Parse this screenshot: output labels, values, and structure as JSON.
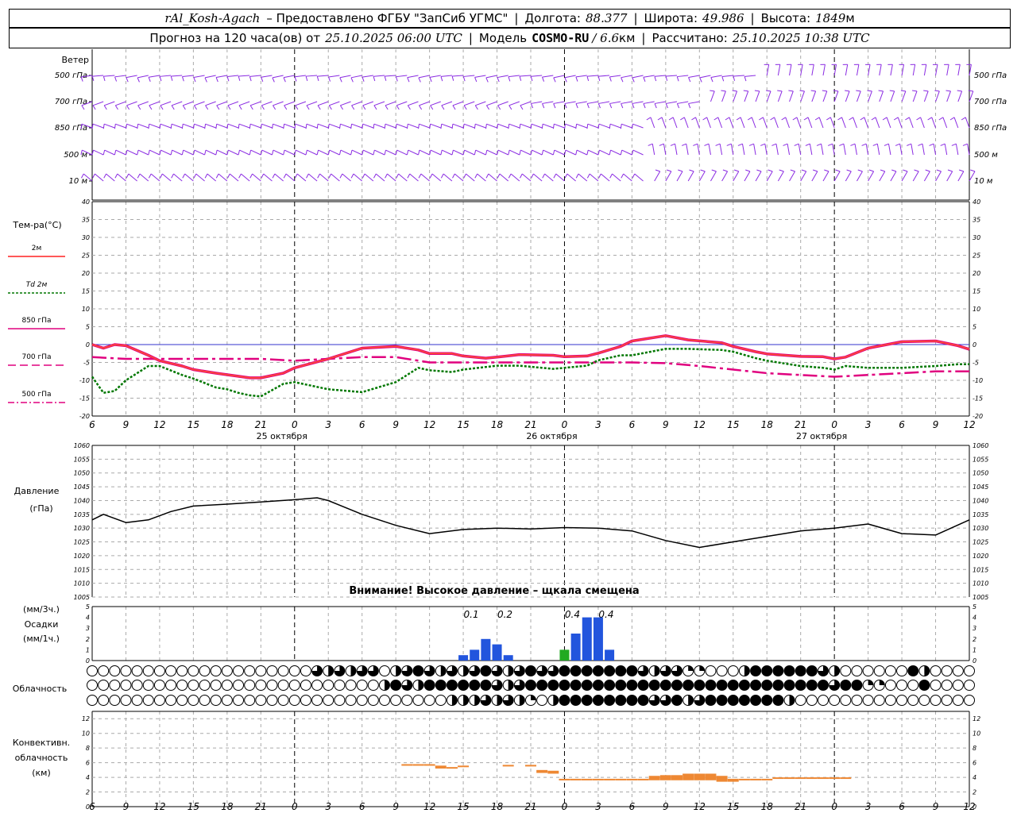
{
  "header": {
    "station": "rAl_Kosh-Agach",
    "provided_by": "– Предоставлено ФГБУ \"ЗапСиб УГМС\"",
    "lon_label": "Долгота:",
    "lon_value": "88.377",
    "lat_label": "Широта:",
    "lat_value": "49.986",
    "alt_label": "Высота:",
    "alt_value": "1849",
    "alt_unit": "м",
    "forecast_prefix": "Прогноз на 120 часа(ов) от",
    "forecast_start": "25.10.2025 06:00 UTC",
    "model_label": "Модель",
    "model_name": "COSMO-RU",
    "model_res": "/ 6.6",
    "model_res_unit": "км",
    "calc_label": "Рассчитано:",
    "calc_time": "25.10.2025 10:38 UTC"
  },
  "wind_panel": {
    "title": "Ветер",
    "levels": [
      "500 гПа",
      "700 гПа",
      "850 гПа",
      "500 м",
      "10 м"
    ],
    "color": "#8a2be2"
  },
  "x_axis": {
    "hour_labels": [
      "6",
      "9",
      "12",
      "15",
      "18",
      "21",
      "0",
      "3",
      "6",
      "9",
      "12",
      "15",
      "18",
      "21",
      "0",
      "3",
      "6",
      "9",
      "12",
      "15",
      "18",
      "21",
      "0",
      "3",
      "6",
      "9",
      "12"
    ],
    "date_labels": [
      "25 октября",
      "26 октября",
      "27 октября"
    ]
  },
  "temp_panel": {
    "title": "Тем-ра(°C)",
    "legend": [
      {
        "label": "2м",
        "color": "#ff2020",
        "style": "solid"
      },
      {
        "label": "Td 2м",
        "color": "#007700",
        "style": "dotted"
      },
      {
        "label": "850 гПа",
        "color": "#e0007f",
        "style": "solid"
      },
      {
        "label": "700 гПа",
        "color": "#e0007f",
        "style": "dashed"
      },
      {
        "label": "500 гПа",
        "color": "#e0007f",
        "style": "dashdot"
      }
    ],
    "y_ticks": [
      "40",
      "35",
      "30",
      "25",
      "20",
      "15",
      "10",
      "5",
      "0",
      "-5",
      "-10",
      "-15",
      "-20"
    ]
  },
  "pressure_panel": {
    "title": "Давление",
    "unit": "(гПа)",
    "y_ticks": [
      "1060",
      "1055",
      "1050",
      "1045",
      "1040",
      "1035",
      "1030",
      "1025",
      "1020",
      "1015",
      "1010",
      "1005"
    ],
    "warning": "Внимание! Высокое давление – щкала смещена"
  },
  "precip_panel": {
    "unit_3h": "(мм/3ч.)",
    "title": "Осадки",
    "unit_1h": "(мм/1ч.)",
    "y_ticks": [
      "5",
      "4",
      "3",
      "2",
      "1",
      "0"
    ],
    "labels": [
      {
        "hour": 33,
        "text": "0.1"
      },
      {
        "hour": 36,
        "text": "0.2"
      },
      {
        "hour": 42,
        "text": "0.4"
      },
      {
        "hour": 45,
        "text": "0.4"
      }
    ]
  },
  "cloud_panel": {
    "title": "Облачность"
  },
  "conv_panel": {
    "title1": "Конвективн.",
    "title2": "облачность",
    "unit": "(км)",
    "y_ticks": [
      "12",
      "10",
      "8",
      "6",
      "4",
      "2",
      "0"
    ],
    "color": "#ee8833"
  },
  "chart_data": [
    {
      "type": "line",
      "title": "Тем-ра(°C)",
      "x_unit": "hours from 25.10.2025 06:00 UTC",
      "ylim": [
        -20,
        40
      ],
      "series": [
        {
          "name": "2м",
          "x": [
            0,
            1,
            2,
            3,
            5,
            6,
            8,
            9,
            11,
            14,
            15,
            17,
            18,
            21,
            24,
            27,
            29,
            30,
            32,
            33,
            35,
            36,
            38,
            41,
            42,
            44,
            45,
            47,
            48,
            51,
            53,
            56,
            57,
            59,
            60,
            63,
            65,
            66,
            67,
            69,
            72,
            75,
            77,
            78
          ],
          "y": [
            0,
            -1,
            0,
            -0.3,
            -3,
            -4.5,
            -6,
            -7,
            -8,
            -9.3,
            -9.3,
            -8,
            -6.5,
            -4,
            -1,
            -0.5,
            -1.5,
            -2.5,
            -2.5,
            -3.2,
            -3.8,
            -3.5,
            -2.8,
            -3,
            -3.4,
            -3.2,
            -2.4,
            -0.5,
            1,
            2.5,
            1.3,
            0.5,
            -0.5,
            -2,
            -2.6,
            -3.3,
            -3.4,
            -4,
            -3.5,
            -1,
            0.8,
            1,
            -0.3,
            -1.3
          ]
        },
        {
          "name": "Td 2м",
          "x": [
            0,
            1,
            2,
            3,
            5,
            6,
            8,
            9,
            11,
            12,
            13,
            14,
            15,
            17,
            18,
            21,
            24,
            27,
            29,
            30,
            32,
            33,
            36,
            38,
            41,
            42,
            44,
            45,
            47,
            48,
            51,
            53,
            56,
            57,
            59,
            60,
            63,
            65,
            66,
            67,
            69,
            72,
            75,
            77,
            78
          ],
          "y": [
            -9,
            -13.5,
            -13,
            -10,
            -6,
            -6,
            -8.5,
            -9.5,
            -12,
            -12.5,
            -13.5,
            -14.2,
            -14.5,
            -11,
            -10.5,
            -12.5,
            -13.3,
            -10.5,
            -6.5,
            -7.2,
            -7.7,
            -7,
            -5.9,
            -5.9,
            -6.8,
            -6.5,
            -5.9,
            -4.4,
            -3,
            -3,
            -1.2,
            -1.2,
            -1.5,
            -2,
            -3.8,
            -4.5,
            -6,
            -6.5,
            -7,
            -6,
            -6.5,
            -6.5,
            -6,
            -5.5,
            -5.5
          ]
        },
        {
          "name": "850 гПа",
          "x": [
            0,
            1,
            2,
            3,
            5,
            6,
            8,
            9,
            11,
            14,
            15,
            17,
            18,
            21,
            24,
            27,
            29,
            30,
            32,
            33,
            35,
            36,
            38,
            41,
            42,
            44,
            45,
            47,
            48,
            51,
            53,
            56,
            57,
            59,
            60,
            63,
            65,
            66,
            67,
            69,
            72,
            75,
            77,
            78
          ],
          "y": [
            0,
            -1,
            0,
            -0.3,
            -3,
            -4.5,
            -6,
            -7,
            -8,
            -9.3,
            -9.3,
            -8,
            -6.5,
            -4,
            -1,
            -0.5,
            -1.5,
            -2.5,
            -2.5,
            -3.2,
            -3.8,
            -3.5,
            -2.8,
            -3,
            -3.4,
            -3.2,
            -2.4,
            -0.5,
            1,
            2.5,
            1.3,
            0.5,
            -0.5,
            -2,
            -2.6,
            -3.3,
            -3.4,
            -4,
            -3.5,
            -1,
            0.8,
            1,
            -0.3,
            -1.3
          ]
        },
        {
          "name": "700 гПа",
          "x": [
            0,
            3,
            6,
            9,
            12,
            15,
            18,
            21,
            24,
            27,
            30,
            33,
            36,
            39,
            42,
            45,
            48,
            51,
            54,
            57,
            60,
            63,
            66,
            69,
            72,
            75,
            78
          ],
          "y": [
            -3.5,
            -4,
            -4,
            -4,
            -4,
            -4,
            -4.5,
            -4,
            -3.5,
            -3.5,
            -5,
            -5,
            -5,
            -5,
            -5,
            -5,
            -5,
            -5.2,
            -6,
            -7,
            -8,
            -8.5,
            -9,
            -8.5,
            -8,
            -7.5,
            -7.5
          ]
        }
      ]
    },
    {
      "type": "line",
      "title": "Давление",
      "x_unit": "hours from 25.10.2025 06:00 UTC",
      "ylim": [
        1005,
        1060
      ],
      "series": [
        {
          "name": "Давление",
          "x": [
            0,
            1,
            3,
            5,
            7,
            9,
            12,
            15,
            18,
            20,
            21,
            24,
            27,
            30,
            33,
            36,
            39,
            42,
            45,
            48,
            51,
            54,
            57,
            60,
            63,
            66,
            69,
            72,
            75,
            78
          ],
          "y": [
            1033,
            1035,
            1032,
            1033,
            1036,
            1038,
            1038.7,
            1039.5,
            1040.3,
            1041,
            1040,
            1035,
            1031,
            1028,
            1029.5,
            1030,
            1029.7,
            1030.2,
            1030,
            1029,
            1025.5,
            1023,
            1025,
            1027,
            1029,
            1030,
            1031.5,
            1028,
            1027.5,
            1033
          ]
        }
      ]
    },
    {
      "type": "bar",
      "title": "Осадки",
      "x_unit": "hours from 25.10.2025 06:00 UTC",
      "ylim": [
        0,
        5
      ],
      "series": [
        {
          "name": "мм/1ч.",
          "x": [
            33,
            34,
            35,
            36,
            37,
            42,
            43,
            44,
            45,
            46
          ],
          "y": [
            0.05,
            0.1,
            0.2,
            0.15,
            0.05,
            0.1,
            0.25,
            0.4,
            0.4,
            0.1
          ]
        }
      ]
    },
    {
      "type": "bar",
      "title": "Конвективн. облачность (км)",
      "x_unit": "hours from 25.10.2025 06:00 UTC",
      "ylim": [
        0,
        13
      ],
      "series": [
        {
          "name": "top_km",
          "x": [
            28,
            29,
            30,
            31,
            32,
            33,
            37,
            39,
            40,
            41,
            42,
            43,
            44,
            45,
            46,
            47,
            48,
            49,
            50,
            51,
            52,
            53,
            54,
            55,
            56,
            57,
            58,
            59,
            60,
            61,
            62,
            63,
            64,
            65,
            66,
            67
          ],
          "y": [
            5.8,
            5.8,
            5.8,
            5.6,
            5.4,
            5.6,
            5.7,
            5.7,
            5,
            4.9,
            3.8,
            3.8,
            3.8,
            3.8,
            3.8,
            3.8,
            3.8,
            3.8,
            4.2,
            4.3,
            4.3,
            4.5,
            4.5,
            4.5,
            4.2,
            3.8,
            3.8,
            3.8,
            3.8,
            4.0,
            4.0,
            4.0,
            4.0,
            4.0,
            4.0,
            4.0
          ]
        },
        {
          "name": "base_km",
          "x": [
            28,
            29,
            30,
            31,
            32,
            33,
            37,
            39,
            40,
            41,
            42,
            43,
            44,
            45,
            46,
            47,
            48,
            49,
            50,
            51,
            52,
            53,
            54,
            55,
            56,
            57,
            58,
            59,
            60,
            61,
            62,
            63,
            64,
            65,
            66,
            67
          ],
          "y": [
            5.6,
            5.6,
            5.6,
            5.2,
            5.2,
            5.4,
            5.5,
            5.5,
            4.6,
            4.5,
            3.6,
            3.6,
            3.6,
            3.6,
            3.6,
            3.6,
            3.6,
            3.6,
            3.6,
            3.6,
            3.6,
            3.6,
            3.6,
            3.6,
            3.4,
            3.4,
            3.6,
            3.6,
            3.6,
            3.8,
            3.8,
            3.8,
            3.8,
            3.8,
            3.8,
            3.8
          ]
        }
      ]
    },
    {
      "type": "table",
      "title": "Облачность",
      "x_unit": "hours from 25.10.2025 06:00 UTC",
      "rows": [
        "upper",
        "middle",
        "lower"
      ],
      "coverage_fraction_per_hour": [
        [
          0,
          0,
          0,
          0,
          0,
          0,
          0,
          0,
          0,
          0,
          0,
          0,
          0,
          0,
          0,
          0,
          0,
          0,
          0,
          0,
          0.75,
          0.5,
          0.75,
          0.5,
          0.75,
          0.75,
          0,
          0.5,
          0.75,
          1,
          0.75,
          0.5,
          0.75,
          0.5,
          0.75,
          1,
          0.75,
          0.5,
          0.75,
          1,
          0.75,
          0.75,
          1,
          1,
          1,
          1,
          1,
          1,
          1,
          0.75,
          0.5,
          0.75,
          0.75,
          0.25,
          0.25,
          0,
          0,
          0,
          0.5,
          1,
          1,
          1,
          1,
          1,
          1,
          0.75,
          0.5,
          0,
          0,
          0,
          0,
          0,
          0,
          1,
          0.5,
          0,
          0,
          0,
          0,
          0
        ],
        [
          0,
          0,
          0,
          0,
          0,
          0,
          0,
          0,
          0,
          0,
          0,
          0,
          0,
          0,
          0,
          0,
          0,
          0,
          0,
          0,
          0,
          0,
          0,
          0,
          0,
          0,
          0.5,
          1,
          0.75,
          0.5,
          1,
          1,
          1,
          1,
          1,
          1,
          0.75,
          0.5,
          0.75,
          1,
          1,
          1,
          1,
          1,
          1,
          1,
          1,
          1,
          1,
          1,
          1,
          1,
          1,
          1,
          1,
          1,
          1,
          1,
          1,
          1,
          1,
          1,
          1,
          1,
          1,
          1,
          0.75,
          1,
          1,
          0.25,
          0.25,
          0,
          0,
          0,
          1,
          0,
          0,
          0,
          0,
          0
        ],
        [
          0,
          0,
          0,
          0,
          0,
          0,
          0,
          0,
          0,
          0,
          0,
          0,
          0,
          0,
          0,
          0,
          0,
          0,
          0,
          0,
          0,
          0,
          0,
          0,
          0,
          0,
          0,
          0,
          0,
          0,
          0,
          0,
          0.5,
          0.5,
          0.5,
          0.75,
          0.5,
          0.75,
          0.5,
          0.25,
          0,
          0.5,
          1,
          1,
          1,
          1,
          1,
          1,
          1,
          1,
          0.75,
          0.75,
          1,
          0.5,
          0.75,
          1,
          1,
          1,
          1,
          1,
          1,
          1,
          0.5,
          0,
          0,
          0,
          0,
          0,
          0,
          0,
          0,
          0,
          0,
          0,
          0,
          0,
          0,
          0,
          0,
          0
        ]
      ]
    }
  ]
}
